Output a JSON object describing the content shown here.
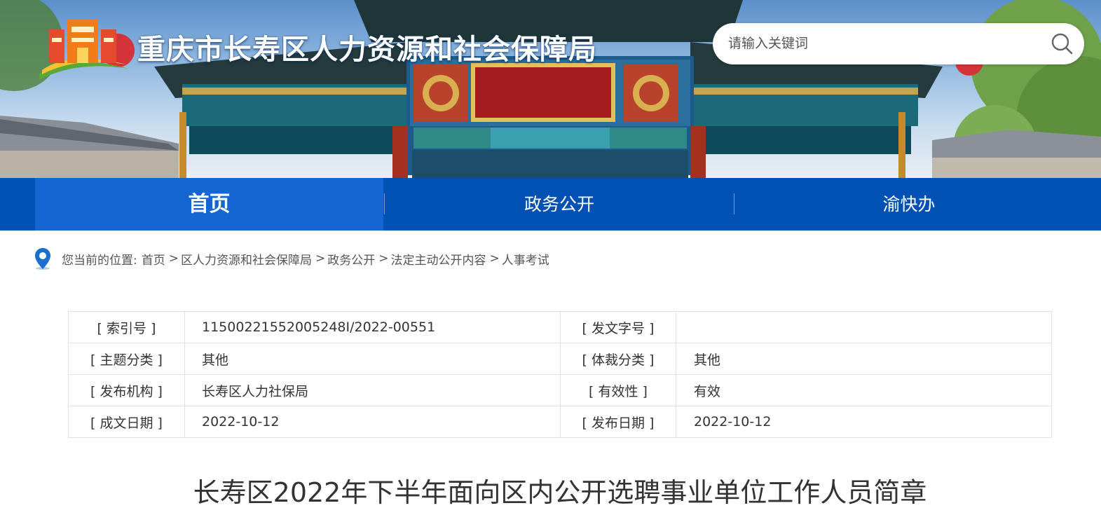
{
  "header": {
    "site_title": "重庆市长寿区人力资源和社会保障局",
    "logo_icon": "city-gate-logo-icon",
    "search_placeholder": "请输入关键词",
    "search_icon": "search-icon"
  },
  "nav": {
    "items": [
      {
        "label": "首页",
        "active": true
      },
      {
        "label": "政务公开",
        "active": false
      },
      {
        "label": "渝快办",
        "active": false
      }
    ]
  },
  "breadcrumb": {
    "icon": "location-pin-icon",
    "prefix": "您当前的位置:",
    "items": [
      "首页",
      "区人力资源和社会保障局",
      "政务公开",
      "法定主动公开内容",
      "人事考试"
    ],
    "separator": ">"
  },
  "info": {
    "rows": [
      {
        "label1": "[ 索引号 ]",
        "value1": "11500221552005248I/2022-00551",
        "label2": "[ 发文字号 ]",
        "value2": ""
      },
      {
        "label1": "[ 主题分类 ]",
        "value1": "其他",
        "label2": "[ 体裁分类 ]",
        "value2": "其他"
      },
      {
        "label1": "[ 发布机构 ]",
        "value1": "长寿区人力社保局",
        "label2": "[ 有效性 ]",
        "value2": "有效"
      },
      {
        "label1": "[ 成文日期 ]",
        "value1": "2022-10-12",
        "label2": "[ 发布日期 ]",
        "value2": "2022-10-12"
      }
    ]
  },
  "article": {
    "title": "长寿区2022年下半年面向区内公开选聘事业单位工作人员简章"
  },
  "colors": {
    "nav_bg": "#0150b4",
    "nav_active": "#1467d2",
    "accent_blue": "#1a6fd0"
  }
}
